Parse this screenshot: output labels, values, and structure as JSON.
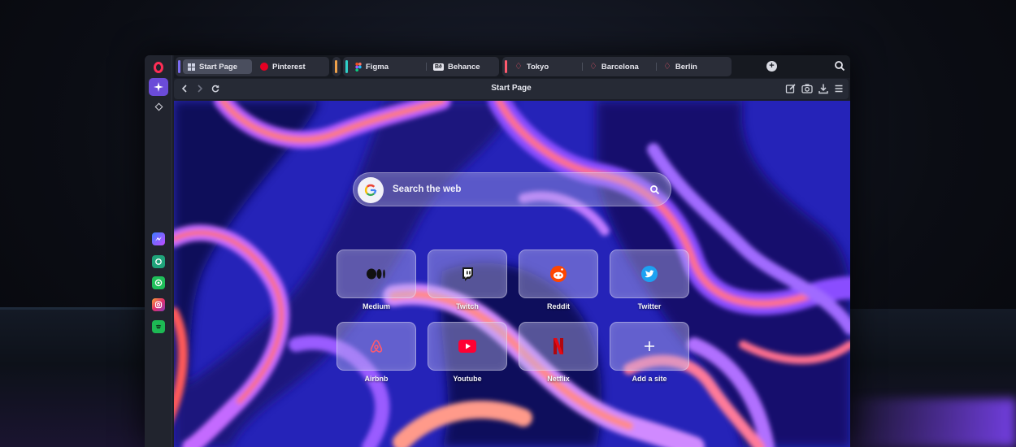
{
  "tabs": {
    "group1": [
      {
        "label": "Start Page",
        "active": true
      },
      {
        "label": "Pinterest"
      }
    ],
    "group2": [
      {
        "label": "Figma"
      },
      {
        "label": "Behance"
      }
    ],
    "group3": [
      {
        "label": "Tokyo"
      },
      {
        "label": "Barcelona"
      },
      {
        "label": "Berlin"
      }
    ],
    "behance_badge": "Bē"
  },
  "addressbar": {
    "title": "Start Page"
  },
  "search": {
    "placeholder": "Search the web"
  },
  "speed_dials": [
    {
      "label": "Medium",
      "icon": "medium-icon"
    },
    {
      "label": "Twitch",
      "icon": "twitch-icon"
    },
    {
      "label": "Reddit",
      "icon": "reddit-icon"
    },
    {
      "label": "Twitter",
      "icon": "twitter-icon"
    },
    {
      "label": "Airbnb",
      "icon": "airbnb-icon"
    },
    {
      "label": "Youtube",
      "icon": "youtube-icon"
    },
    {
      "label": "Netflix",
      "icon": "netflix-icon"
    },
    {
      "label": "Add a site",
      "icon": "plus-icon"
    }
  ],
  "sidebar_apps": [
    "messenger-icon",
    "chatgpt-icon",
    "whatsapp-icon",
    "instagram-icon",
    "spotify-icon"
  ],
  "colors": {
    "opera_red": "#ff2d55",
    "aria_purple": "#6b4bd8",
    "tab_group1": "#7b6cf2",
    "tab_group2": "#f0a24a",
    "tab_group2b": "#2fd0c8",
    "tab_group3": "#ff5a6e"
  }
}
